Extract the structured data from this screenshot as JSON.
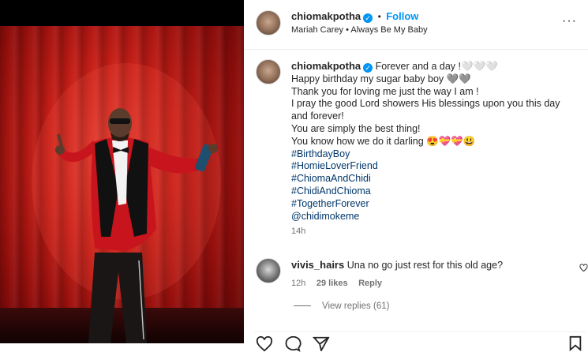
{
  "post": {
    "author": "chiomakpotha",
    "follow_label": "Follow",
    "audio_line": "Mariah Carey • Always Be My Baby",
    "more_glyph": "···"
  },
  "caption": {
    "lines": [
      "Forever and a day !🤍🤍🤍",
      "Happy birthday my sugar baby boy 🩶🩶",
      "Thank you for loving me just the way I am !",
      "I pray the good Lord showers His blessings upon you this day",
      "and forever!",
      "You are simply the best thing!",
      "You know how we do it darling 😍💝💝😃"
    ],
    "hashtags": [
      "#BirthdayBoy",
      "#HomieLoverFriend",
      "#ChiomaAndChidi",
      "#ChidiAndChioma",
      "#TogetherForever",
      "@chidimokeme"
    ],
    "time": "14h"
  },
  "comment": {
    "author": "vivis_hairs",
    "text": "Una no go just rest for this old age?",
    "time": "12h",
    "likes": "29 likes",
    "reply_label": "Reply"
  },
  "view_replies": "View replies (61)",
  "colors": {
    "link": "#00376b",
    "accent": "#0095f6",
    "muted": "#737373",
    "curtain": "#c41d16",
    "jacket": "#c8141c"
  },
  "icons": [
    "verified-badge-icon",
    "more-options-icon",
    "heart-icon",
    "comment-icon",
    "share-icon",
    "bookmark-icon"
  ]
}
